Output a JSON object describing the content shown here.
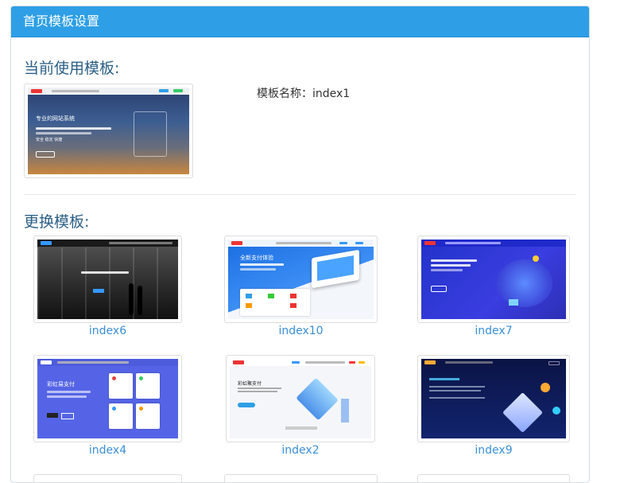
{
  "panel": {
    "title": "首页模板设置"
  },
  "current": {
    "heading": "当前使用模板:",
    "name_label": "模板名称：index1",
    "thumb_headline": "专业的网站系统",
    "thumb_sub": "安全 稳定 快捷"
  },
  "change": {
    "heading": "更换模板:",
    "templates": [
      {
        "name": "index6"
      },
      {
        "name": "index10",
        "headline": "全新支付体验"
      },
      {
        "name": "index7"
      },
      {
        "name": "index4",
        "headline": "彩虹易支付"
      },
      {
        "name": "index2",
        "headline": "彩虹聚支付"
      },
      {
        "name": "index9"
      }
    ]
  },
  "colors": {
    "header": "#2e9fe6",
    "heading": "#2b5f87",
    "link": "#3a8fd6"
  }
}
